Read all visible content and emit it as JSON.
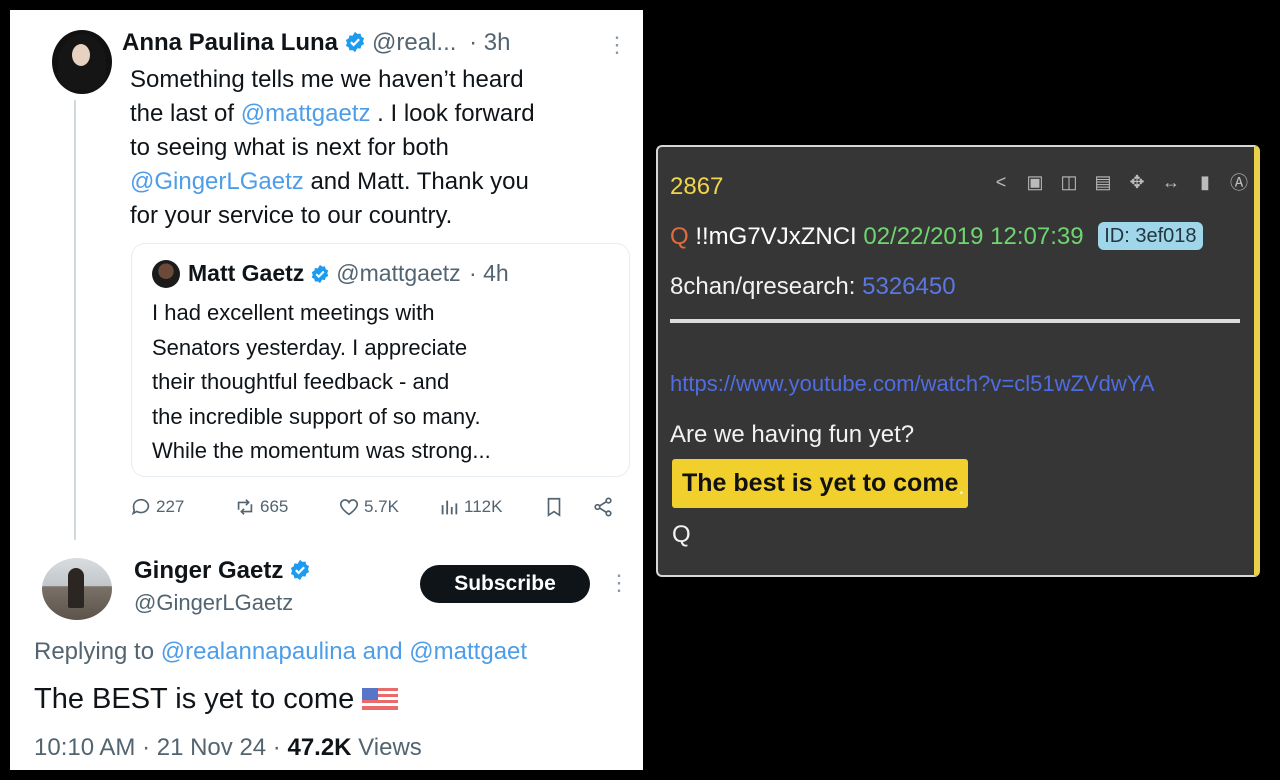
{
  "tweet": {
    "author": {
      "name": "Anna Paulina Luna",
      "handle": "@real...",
      "time": "· 3h"
    },
    "body": {
      "line1": "Something tells me we haven’t heard",
      "line2_pre": "the last of ",
      "mention1": "@mattgaetz",
      "line2_post": " . I look forward",
      "line3": "to seeing what is next for both",
      "mention2": "@GingerLGaetz",
      "line4_post": " and Matt. Thank you",
      "line5": "for your service to our country."
    },
    "quote": {
      "name": "Matt Gaetz",
      "handle": "@mattgaetz",
      "time": "· 4h",
      "lines": [
        "I had excellent meetings with",
        "Senators yesterday.  I appreciate",
        "their thoughtful feedback - and",
        "the incredible support of so many.",
        "While the momentum was strong..."
      ]
    },
    "actions": {
      "replies": "227",
      "reposts": "665",
      "likes": "5.7K",
      "views": "112K"
    }
  },
  "reply": {
    "name": "Ginger Gaetz",
    "handle": "@GingerLGaetz",
    "subscribe_label": "Subscribe",
    "replying_prefix": "Replying to ",
    "replying_to": "@realannapaulina and @mattgaet",
    "text": "The BEST is yet to come",
    "time": "10:10 AM · 21 Nov 24 · ",
    "views_count": "47.2K",
    "views_label": " Views"
  },
  "qpost": {
    "post_number": "2867",
    "name": "Q",
    "tripcode": "!!mG7VJxZNCI",
    "datetime": "02/22/2019 12:07:39",
    "id": "ID: 3ef018",
    "board": "8chan/qresearch: ",
    "board_post": "5326450",
    "url": "https://www.youtube.com/watch?v=cl51wZVdwYA",
    "text1": "Are we having fun yet?",
    "highlight": "The best is yet to come",
    "period": ".",
    "signature": "Q"
  },
  "colors": {
    "link_blue": "#4d9de8",
    "verified_blue": "#1d9bf0",
    "q_panel_bg": "#363636",
    "q_highlight": "#f1cf2d",
    "q_date_green": "#6fd66f",
    "q_postnum_yellow": "#f0d64a"
  }
}
